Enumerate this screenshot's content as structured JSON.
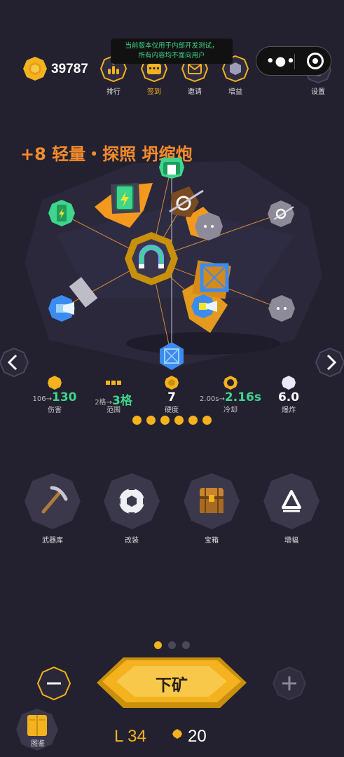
{
  "header": {
    "coins": "39787",
    "dev_notice_line1": "当前版本仅用于内部开发测试，",
    "dev_notice_line2": "所有内容均不面向用户",
    "nav": [
      {
        "label": "排行",
        "icon": "ranking-icon"
      },
      {
        "label": "签到",
        "icon": "checkin-icon",
        "active": true
      },
      {
        "label": "邀请",
        "icon": "invite-mail-icon"
      },
      {
        "label": "增益",
        "icon": "buff-icon"
      },
      {
        "label": "设置",
        "icon": "gear-icon"
      }
    ]
  },
  "weapon": {
    "title": "+8 轻量・探照 坍缩炮"
  },
  "stats": [
    {
      "from": "106",
      "to": "130",
      "label": "伤害",
      "icon": "damage-gem-icon"
    },
    {
      "from": "2格",
      "to": "3格",
      "label": "范围",
      "icon": "range-bar-icon"
    },
    {
      "value": "7",
      "label": "硬度",
      "icon": "hardness-gem-icon"
    },
    {
      "from": "2.00s",
      "to": "2.16s",
      "label": "冷却",
      "icon": "cooldown-nut-icon"
    },
    {
      "value": "6.0",
      "label": "爆炸",
      "icon": "explosion-gem-icon"
    }
  ],
  "arrow_glyph": "→",
  "actions": [
    {
      "label": "武器库",
      "icon": "pickaxe-icon"
    },
    {
      "label": "改装",
      "icon": "saw-nut-icon"
    },
    {
      "label": "宝箱",
      "icon": "treasure-chest-icon"
    },
    {
      "label": "增幅",
      "icon": "amplify-triangle-icon"
    }
  ],
  "bottom": {
    "mine_label": "下矿",
    "level": "L 34",
    "gems": "20",
    "codex_label": "图鉴"
  },
  "colors": {
    "background": "#232130",
    "gold": "#f3b21e",
    "orange_title": "#f48b2c",
    "stat_green": "#3ed58d"
  }
}
